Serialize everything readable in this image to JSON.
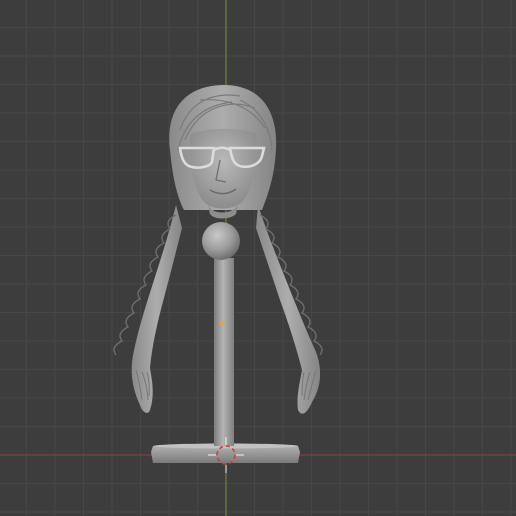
{
  "viewport": {
    "background": "#3d3d3d",
    "grid_minor_color": "#474747",
    "grid_major_color": "#515151",
    "x_axis_color": "#9a3a47",
    "z_axis_color": "#6b9a2a",
    "model_color": "#9a9a9a",
    "model_shadow": "#6e6e6e",
    "model_highlight": "#bdbdbd",
    "origin_color": "#f0a23a",
    "cursor_red": "#d43a3a",
    "cursor_white": "#f2f2f2"
  },
  "scene": {
    "object": "bust-with-braids-on-stand",
    "icons": {
      "origin": "origin-dot-icon",
      "cursor": "3d-cursor-icon"
    }
  }
}
